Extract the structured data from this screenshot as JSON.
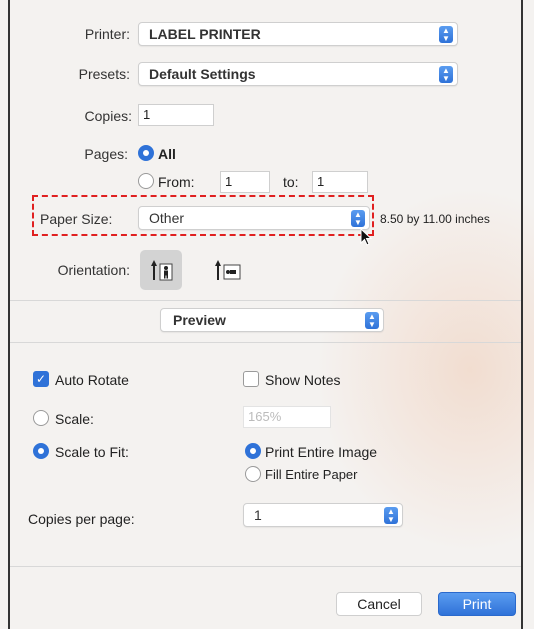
{
  "printer": {
    "label": "Printer:",
    "value": "LABEL PRINTER"
  },
  "presets": {
    "label": "Presets:",
    "value": "Default Settings"
  },
  "copies": {
    "label": "Copies:",
    "value": "1"
  },
  "pages": {
    "label": "Pages:",
    "all_label": "All",
    "from_label": "From:",
    "from_value": "1",
    "to_label": "to:",
    "to_value": "1"
  },
  "paper_size": {
    "label": "Paper Size:",
    "value": "Other",
    "dimensions": "8.50 by 11.00 inches"
  },
  "orientation": {
    "label": "Orientation:"
  },
  "section": {
    "value": "Preview"
  },
  "options": {
    "auto_rotate": "Auto Rotate",
    "show_notes": "Show Notes",
    "scale_label": "Scale:",
    "scale_value": "165%",
    "scale_to_fit": "Scale to Fit:",
    "print_entire_image": "Print Entire Image",
    "fill_entire_paper": "Fill Entire Paper"
  },
  "copies_per_page": {
    "label": "Copies per page:",
    "value": "1"
  },
  "buttons": {
    "cancel": "Cancel",
    "print": "Print"
  },
  "colors": {
    "accent": "#2f72d8",
    "highlight_border": "#e02020"
  }
}
